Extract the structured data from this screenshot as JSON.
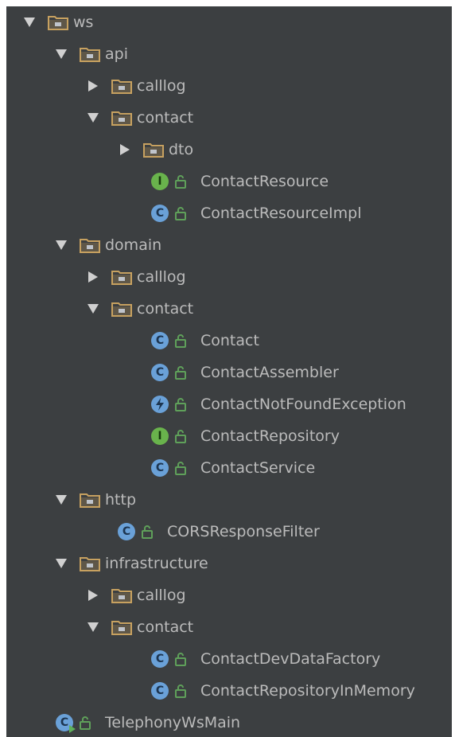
{
  "tree": [
    {
      "label": "ws",
      "kind": "folder",
      "expanded": true,
      "depth": 0
    },
    {
      "label": "api",
      "kind": "folder",
      "expanded": true,
      "depth": 1
    },
    {
      "label": "calllog",
      "kind": "folder",
      "expanded": false,
      "depth": 2
    },
    {
      "label": "contact",
      "kind": "folder",
      "expanded": true,
      "depth": 2
    },
    {
      "label": "dto",
      "kind": "folder",
      "expanded": false,
      "depth": 3
    },
    {
      "label": "ContactResource",
      "kind": "interface",
      "depth": 3
    },
    {
      "label": "ContactResourceImpl",
      "kind": "class",
      "depth": 3
    },
    {
      "label": "domain",
      "kind": "folder",
      "expanded": true,
      "depth": 1
    },
    {
      "label": "calllog",
      "kind": "folder",
      "expanded": false,
      "depth": 2
    },
    {
      "label": "contact",
      "kind": "folder",
      "expanded": true,
      "depth": 2
    },
    {
      "label": "Contact",
      "kind": "class",
      "depth": 3
    },
    {
      "label": "ContactAssembler",
      "kind": "class",
      "depth": 3
    },
    {
      "label": "ContactNotFoundException",
      "kind": "exception",
      "depth": 3
    },
    {
      "label": "ContactRepository",
      "kind": "interface",
      "depth": 3
    },
    {
      "label": "ContactService",
      "kind": "class",
      "depth": 3
    },
    {
      "label": "http",
      "kind": "folder",
      "expanded": true,
      "depth": 1
    },
    {
      "label": "CORSResponseFilter",
      "kind": "class",
      "depth": 2
    },
    {
      "label": "infrastructure",
      "kind": "folder",
      "expanded": true,
      "depth": 1
    },
    {
      "label": "calllog",
      "kind": "folder",
      "expanded": false,
      "depth": 2
    },
    {
      "label": "contact",
      "kind": "folder",
      "expanded": true,
      "depth": 2
    },
    {
      "label": "ContactDevDataFactory",
      "kind": "class",
      "depth": 3
    },
    {
      "label": "ContactRepositoryInMemory",
      "kind": "class",
      "depth": 3
    },
    {
      "label": "TelephonyWsMain",
      "kind": "main-class",
      "depth": 1
    }
  ],
  "icons": {
    "folder": "folder-icon",
    "class": "class-c-icon",
    "interface": "interface-i-icon",
    "exception": "exception-icon",
    "main-class": "main-class-icon",
    "lock": "lock-icon"
  },
  "colors": {
    "background": "#3c3f41",
    "text": "#bbbbbb",
    "folder": "#c7a160",
    "class_blue": "#6aa1d8",
    "interface_green": "#69b34c"
  }
}
